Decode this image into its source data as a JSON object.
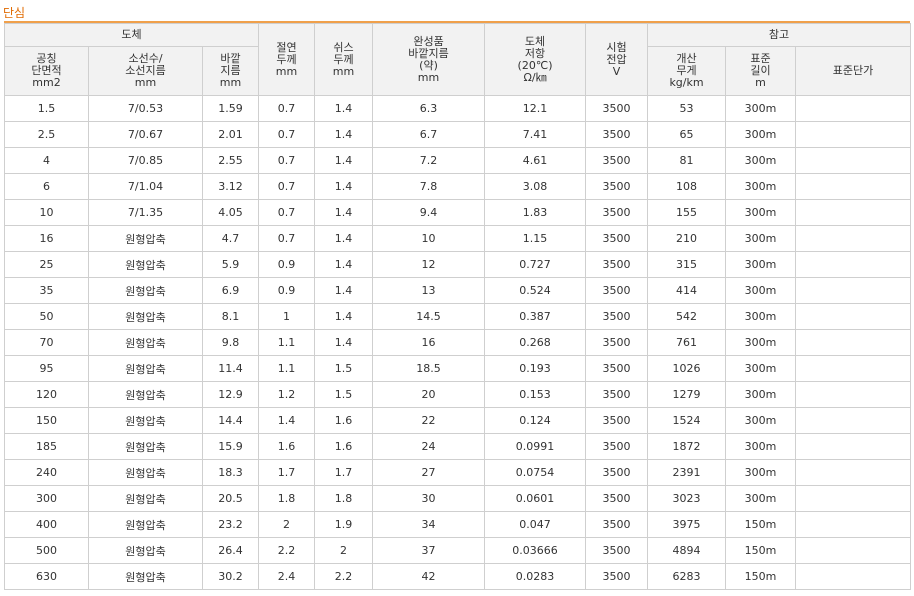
{
  "title": "단심",
  "colors": {
    "title": "#e06a00",
    "rule": "#f0a04b",
    "header_bg": "#f2f2f2",
    "border": "#cfcfcf"
  },
  "header": {
    "group_conductor": "도체",
    "group_reference": "참고",
    "nominal_area": [
      "공칭",
      "단면적",
      "mm2"
    ],
    "strand": [
      "소선수/",
      "소선지름",
      "mm"
    ],
    "outer_dia": [
      "바깥",
      "지름",
      "mm"
    ],
    "insulation": [
      "절연",
      "두께",
      "mm"
    ],
    "sheath": [
      "쉬스",
      "두께",
      "mm"
    ],
    "finished_dia": [
      "완성품",
      "바깥지름",
      "(약)",
      "mm"
    ],
    "resistance": [
      "도체",
      "저항",
      "(20℃)",
      "Ω/㎞"
    ],
    "test_voltage": [
      "시험",
      "전압",
      "V"
    ],
    "weight": [
      "개산",
      "무게",
      "kg/km"
    ],
    "std_length": [
      "표준",
      "길이",
      "m"
    ],
    "unit_price": "표준단가"
  },
  "rows": [
    [
      "1.5",
      "7/0.53",
      "1.59",
      "0.7",
      "1.4",
      "6.3",
      "12.1",
      "3500",
      "53",
      "300m",
      ""
    ],
    [
      "2.5",
      "7/0.67",
      "2.01",
      "0.7",
      "1.4",
      "6.7",
      "7.41",
      "3500",
      "65",
      "300m",
      ""
    ],
    [
      "4",
      "7/0.85",
      "2.55",
      "0.7",
      "1.4",
      "7.2",
      "4.61",
      "3500",
      "81",
      "300m",
      ""
    ],
    [
      "6",
      "7/1.04",
      "3.12",
      "0.7",
      "1.4",
      "7.8",
      "3.08",
      "3500",
      "108",
      "300m",
      ""
    ],
    [
      "10",
      "7/1.35",
      "4.05",
      "0.7",
      "1.4",
      "9.4",
      "1.83",
      "3500",
      "155",
      "300m",
      ""
    ],
    [
      "16",
      "원형압축",
      "4.7",
      "0.7",
      "1.4",
      "10",
      "1.15",
      "3500",
      "210",
      "300m",
      ""
    ],
    [
      "25",
      "원형압축",
      "5.9",
      "0.9",
      "1.4",
      "12",
      "0.727",
      "3500",
      "315",
      "300m",
      ""
    ],
    [
      "35",
      "원형압축",
      "6.9",
      "0.9",
      "1.4",
      "13",
      "0.524",
      "3500",
      "414",
      "300m",
      ""
    ],
    [
      "50",
      "원형압축",
      "8.1",
      "1",
      "1.4",
      "14.5",
      "0.387",
      "3500",
      "542",
      "300m",
      ""
    ],
    [
      "70",
      "원형압축",
      "9.8",
      "1.1",
      "1.4",
      "16",
      "0.268",
      "3500",
      "761",
      "300m",
      ""
    ],
    [
      "95",
      "원형압축",
      "11.4",
      "1.1",
      "1.5",
      "18.5",
      "0.193",
      "3500",
      "1026",
      "300m",
      ""
    ],
    [
      "120",
      "원형압축",
      "12.9",
      "1.2",
      "1.5",
      "20",
      "0.153",
      "3500",
      "1279",
      "300m",
      ""
    ],
    [
      "150",
      "원형압축",
      "14.4",
      "1.4",
      "1.6",
      "22",
      "0.124",
      "3500",
      "1524",
      "300m",
      ""
    ],
    [
      "185",
      "원형압축",
      "15.9",
      "1.6",
      "1.6",
      "24",
      "0.0991",
      "3500",
      "1872",
      "300m",
      ""
    ],
    [
      "240",
      "원형압축",
      "18.3",
      "1.7",
      "1.7",
      "27",
      "0.0754",
      "3500",
      "2391",
      "300m",
      ""
    ],
    [
      "300",
      "원형압축",
      "20.5",
      "1.8",
      "1.8",
      "30",
      "0.0601",
      "3500",
      "3023",
      "300m",
      ""
    ],
    [
      "400",
      "원형압축",
      "23.2",
      "2",
      "1.9",
      "34",
      "0.047",
      "3500",
      "3975",
      "150m",
      ""
    ],
    [
      "500",
      "원형압축",
      "26.4",
      "2.2",
      "2",
      "37",
      "0.03666",
      "3500",
      "4894",
      "150m",
      ""
    ],
    [
      "630",
      "원형압축",
      "30.2",
      "2.4",
      "2.2",
      "42",
      "0.0283",
      "3500",
      "6283",
      "150m",
      ""
    ]
  ]
}
